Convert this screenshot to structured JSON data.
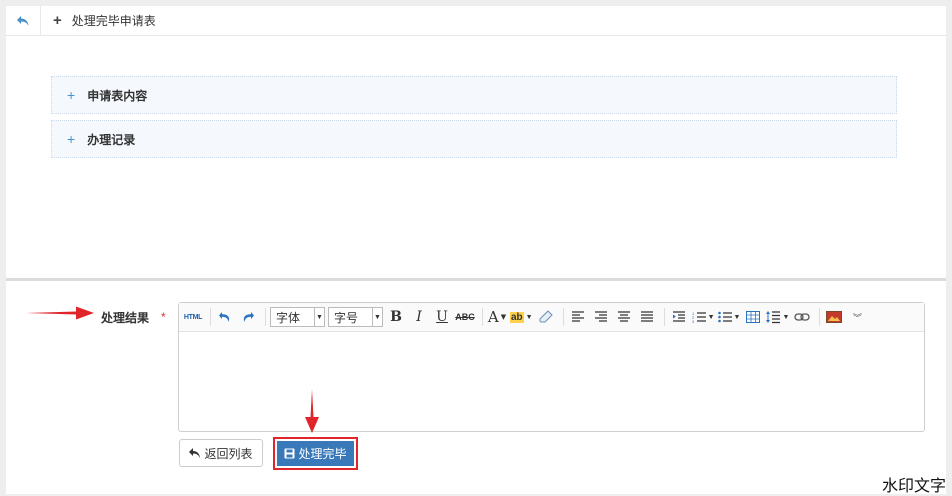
{
  "header": {
    "back_icon": "undo-arrow-icon",
    "plus_icon": "plus-icon",
    "tab_title": "处理完毕申请表"
  },
  "panels": [
    {
      "label": "申请表内容"
    },
    {
      "label": "办理记录"
    }
  ],
  "form": {
    "result_label": "处理结果",
    "required_mark": "*"
  },
  "editor": {
    "html_label": "HTML",
    "font_select": "字体",
    "size_select": "字号",
    "bold_label": "B",
    "italic_label": "I",
    "underline_label": "U",
    "strike_label": "ABC",
    "font_color_label": "A",
    "highlight_label": "ab"
  },
  "buttons": {
    "back_label": "返回列表",
    "done_label": "处理完毕"
  },
  "watermark": "水印文字",
  "colors": {
    "primary": "#3a79b9",
    "annotation_red": "#e0262b",
    "panel_bg": "#f5f9fd"
  }
}
